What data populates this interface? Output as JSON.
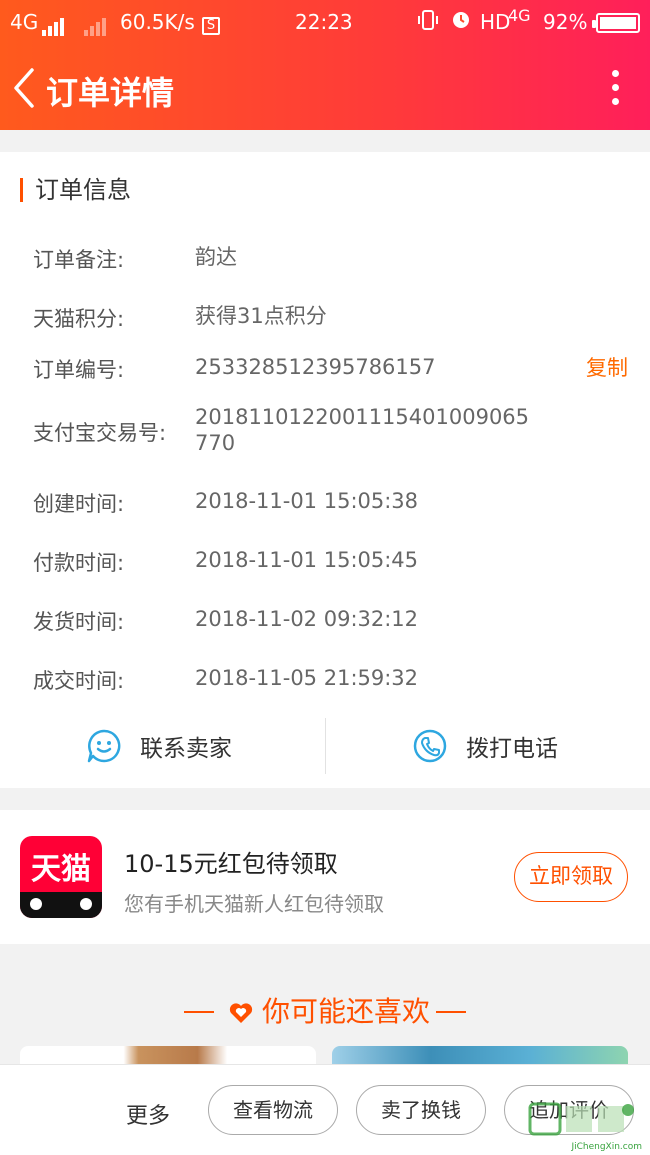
{
  "status_bar": {
    "network_left": "4G",
    "speed": "60.5K/s",
    "time": "22:23",
    "hd": "HD",
    "network_right": "4G",
    "battery": "92%"
  },
  "nav": {
    "title": "订单详情"
  },
  "order_info": {
    "section_title": "订单信息",
    "rows": [
      {
        "label": "订单备注:",
        "value": "韵达"
      },
      {
        "label": "天猫积分:",
        "value": "获得31点积分"
      },
      {
        "label": "订单编号:",
        "value": "253328512395786157"
      },
      {
        "label": "支付宝交易号:",
        "value": "2018110122001115401009065770"
      },
      {
        "label": "创建时间:",
        "value": "2018-11-01 15:05:38"
      },
      {
        "label": "付款时间:",
        "value": "2018-11-01 15:05:45"
      },
      {
        "label": "发货时间:",
        "value": "2018-11-02 09:32:12"
      },
      {
        "label": "成交时间:",
        "value": "2018-11-05 21:59:32"
      }
    ],
    "copy_label": "复制",
    "contact_seller": "联系卖家",
    "call_phone": "拨打电话"
  },
  "promo": {
    "logo_text": "天猫",
    "title": "10-15元红包待领取",
    "subtitle": "您有手机天猫新人红包待领取",
    "claim_label": "立即领取"
  },
  "recommend": {
    "title": "你可能还喜欢"
  },
  "bottom_bar": {
    "more_label": "更多",
    "buttons": [
      "查看物流",
      "卖了换钱",
      "追加评价"
    ]
  },
  "watermark": {
    "text": "JiChengXin.com"
  },
  "colors": {
    "accent": "#ff5000",
    "header_start": "#ff5a1d",
    "header_end": "#ff1f5a",
    "icon_blue": "#2ea7e0"
  }
}
